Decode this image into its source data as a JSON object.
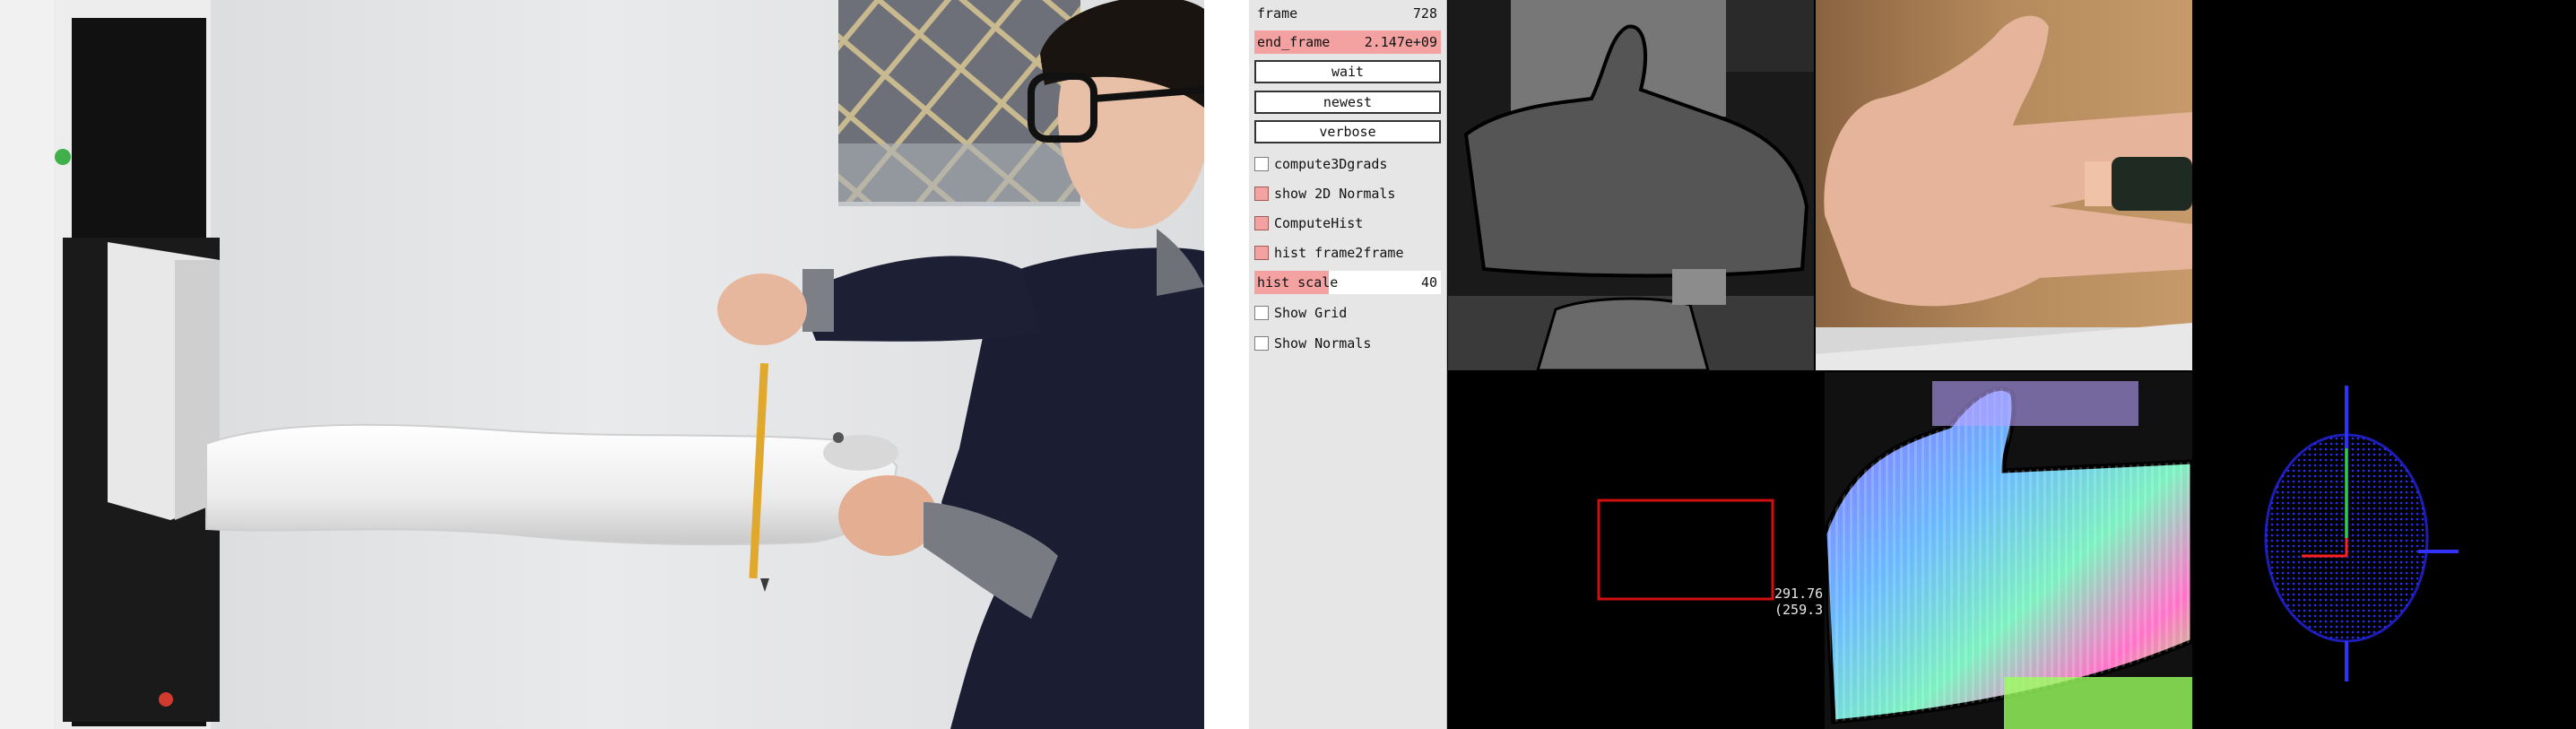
{
  "panel": {
    "frame_label": "frame",
    "frame_value": "728",
    "end_frame_label": "end_frame",
    "end_frame_value": "2.147e+09",
    "wait_label": "wait",
    "newest_label": "newest",
    "verbose_label": "verbose",
    "compute3d_label": "compute3Dgrads",
    "show2d_label": "show 2D Normals",
    "computehist_label": "ComputeHist",
    "histf2f_label": "hist frame2frame",
    "hist_scale_label": "hist scale",
    "hist_scale_value": "40",
    "show_grid_label": "Show Grid",
    "show_normals_label": "Show Normals"
  },
  "views": {
    "readout_line1": "291.76",
    "readout_line2": "(259.3"
  },
  "colors": {
    "panel_bg": "#e6e6e6",
    "checked_fill": "#f4a1a1",
    "roi_box": "#d01010",
    "axis_x": "#ff2020",
    "axis_y": "#20dd20",
    "axis_z": "#3030ff"
  }
}
